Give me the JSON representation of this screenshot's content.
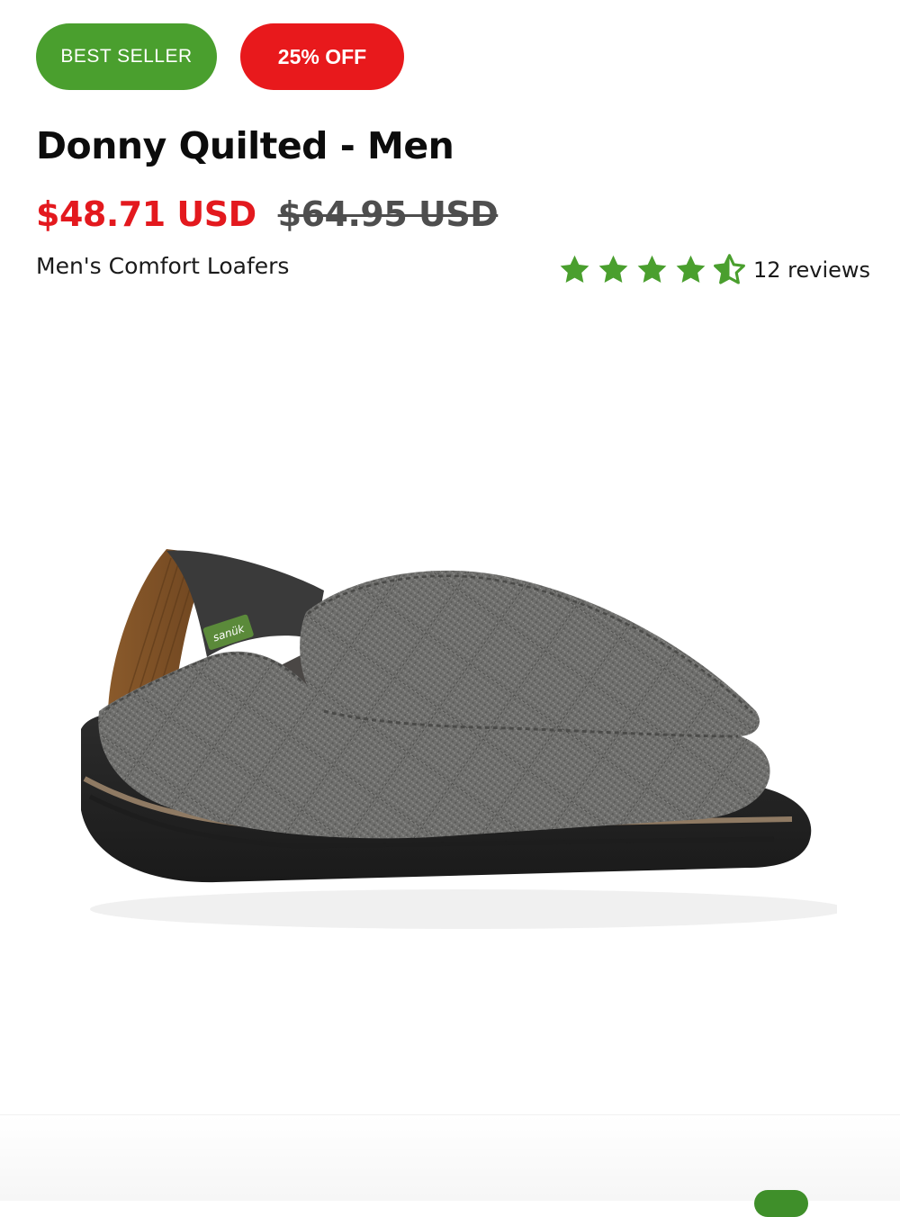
{
  "badges": {
    "best_seller": "BEST SELLER",
    "discount": "25% OFF"
  },
  "product": {
    "title": "Donny Quilted - Men",
    "sale_price": "$48.71 USD",
    "original_price": "$64.95 USD",
    "category": "Men's Comfort Loafers",
    "rating": 4.5,
    "rating_max": 5,
    "reviews_label": "12 reviews",
    "image_label": "sanük"
  },
  "colors": {
    "best_seller_badge": "#4a9f2e",
    "discount_badge": "#e8191c",
    "sale_price": "#e3191e",
    "star": "#4a9f2e"
  },
  "icons": {
    "star": "star-icon",
    "half_star": "half-star-icon"
  }
}
